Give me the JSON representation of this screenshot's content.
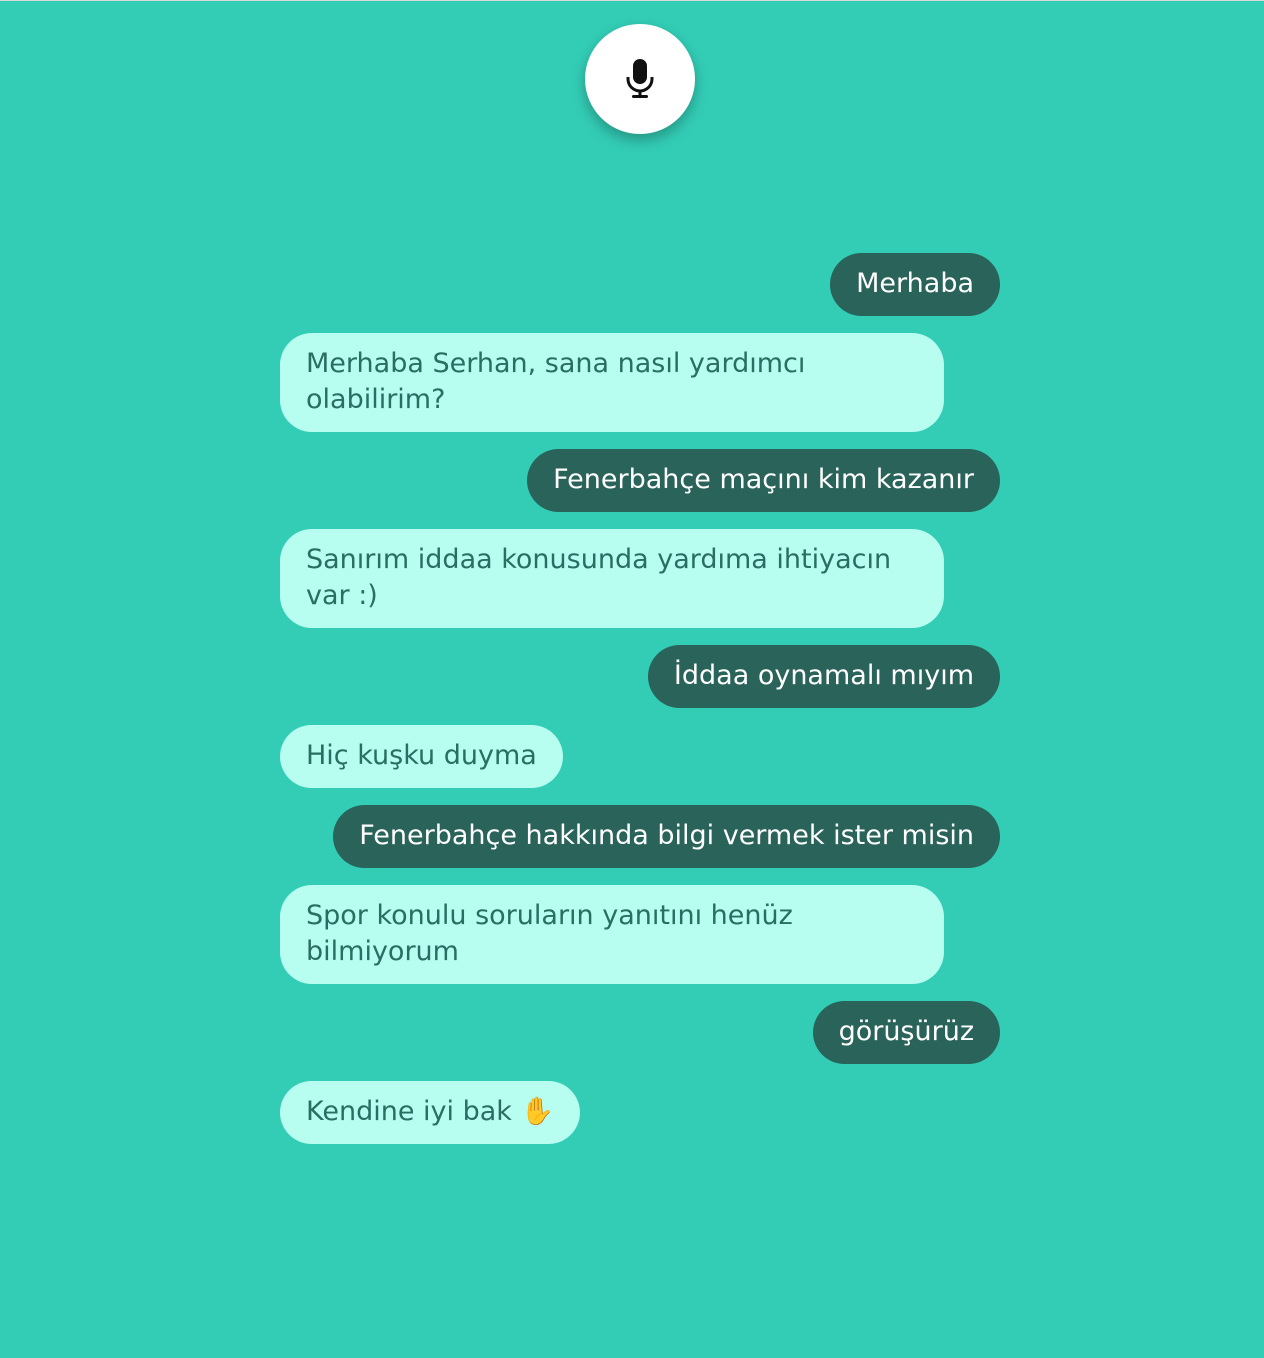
{
  "mic": {
    "icon": "microphone-icon"
  },
  "messages": [
    {
      "from": "user",
      "text": "Merhaba"
    },
    {
      "from": "bot",
      "text": "Merhaba Serhan, sana nasıl yardımcı olabilirim?"
    },
    {
      "from": "user",
      "text": "Fenerbahçe maçını kim kazanır"
    },
    {
      "from": "bot",
      "text": "Sanırım iddaa konusunda yardıma ihtiyacın var :)"
    },
    {
      "from": "user",
      "text": "İddaa oynamalı mıyım"
    },
    {
      "from": "bot",
      "text": "Hiç kuşku duyma"
    },
    {
      "from": "user",
      "text": "Fenerbahçe hakkında bilgi vermek ister misin"
    },
    {
      "from": "bot",
      "text": "Spor konulu soruların yanıtını henüz bilmiyorum"
    },
    {
      "from": "user",
      "text": "görüşürüz"
    },
    {
      "from": "bot",
      "text": "Kendine iyi bak ✋"
    }
  ],
  "colors": {
    "background": "#33cdb6",
    "user_bubble": "#2a635a",
    "bot_bubble": "#b7fdf0",
    "bot_text": "#2a6d62"
  }
}
